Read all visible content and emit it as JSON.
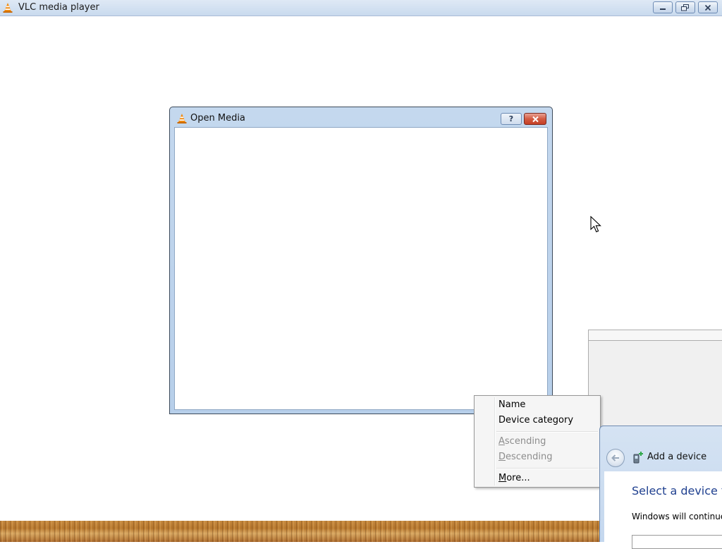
{
  "vlc": {
    "title": "VLC media player",
    "icon": "vlc-cone-icon",
    "buttons": {
      "minimize": "minimize-icon",
      "restore": "restore-icon",
      "close": "close-icon"
    }
  },
  "open_media": {
    "title": "Open Media",
    "help_label": "?",
    "close": "close-icon"
  },
  "context_menu": {
    "items": [
      {
        "label": "Name",
        "enabled": true
      },
      {
        "label": "Device category",
        "enabled": true
      },
      {
        "label": "Ascending",
        "enabled": false
      },
      {
        "label": "Descending",
        "enabled": false
      },
      {
        "label": "More...",
        "enabled": true
      }
    ]
  },
  "add_device": {
    "title": "Add a device",
    "heading": "Select a device to",
    "description": "Windows will continue t"
  },
  "colors": {
    "heading_blue": "#1e3f8f",
    "close_red": "#c43f26",
    "titlebar_blue": "#c4d8ee"
  }
}
